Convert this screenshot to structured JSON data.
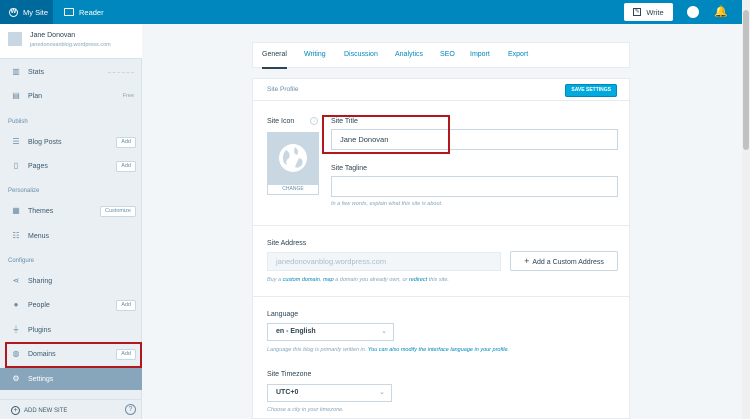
{
  "topbar": {
    "my_site": "My Site",
    "reader": "Reader",
    "write": "Write"
  },
  "sidebar": {
    "profile": {
      "name": "Jane Donovan",
      "url": "janedonovanblog.wordpress.com"
    },
    "stats": "Stats",
    "plan": "Plan",
    "plan_tag": "Free",
    "publish_heading": "Publish",
    "blog_posts": "Blog Posts",
    "pages": "Pages",
    "add": "Add",
    "personalize_heading": "Personalize",
    "themes": "Themes",
    "customize": "Customize",
    "menus": "Menus",
    "configure_heading": "Configure",
    "sharing": "Sharing",
    "people": "People",
    "plugins": "Plugins",
    "domains": "Domains",
    "settings": "Settings",
    "add_new_site": "ADD NEW SITE",
    "help": "?"
  },
  "tabs": [
    "General",
    "Writing",
    "Discussion",
    "Analytics",
    "SEO",
    "Import",
    "Export"
  ],
  "settings": {
    "section_title": "Site Profile",
    "save_settings": "SAVE SETTINGS",
    "site_icon_label": "Site Icon",
    "change": "CHANGE",
    "site_title_label": "Site Title",
    "site_title_value": "Jane Donovan",
    "site_tagline_label": "Site Tagline",
    "site_tagline_value": "",
    "tagline_help": "In a few words, explain what this site is about.",
    "site_address_label": "Site Address",
    "site_address_value": "janedonovanblog.wordpress.com",
    "add_custom_address": "Add a Custom Address",
    "address_help_1": "Buy a ",
    "address_help_link1": "custom domain",
    "address_help_2": ", ",
    "address_help_link2": "map",
    "address_help_3": " a domain you already own, or ",
    "address_help_link3": "redirect",
    "address_help_4": " this site.",
    "language_label": "Language",
    "language_value": "en - English",
    "language_help_1": "Language this blog is primarily written in. ",
    "language_help_link": "You can also modify the interface language in your profile.",
    "timezone_label": "Site Timezone",
    "timezone_value": "UTC+0",
    "timezone_help": "Choose a city in your timezone."
  }
}
